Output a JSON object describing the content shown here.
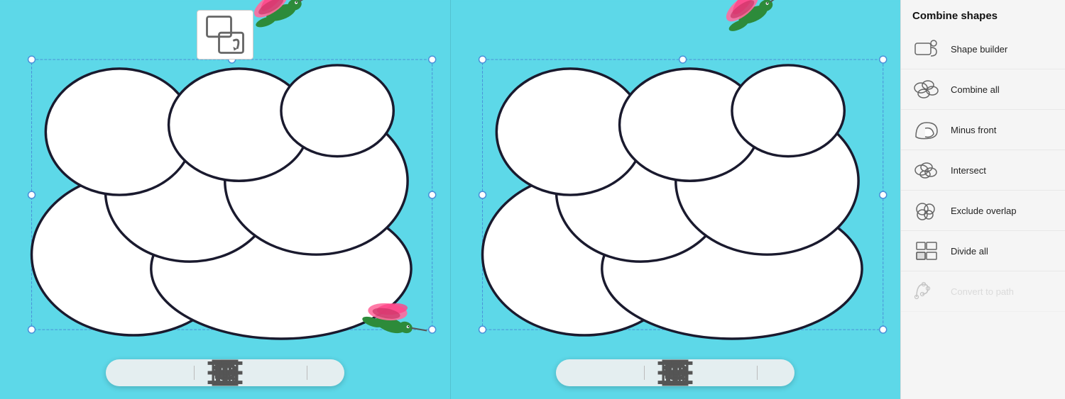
{
  "panel": {
    "title": "Combine shapes",
    "items": [
      {
        "id": "shape-builder",
        "label": "Shape builder",
        "disabled": false
      },
      {
        "id": "combine-all",
        "label": "Combine all",
        "disabled": false
      },
      {
        "id": "minus-front",
        "label": "Minus front",
        "disabled": false
      },
      {
        "id": "intersect",
        "label": "Intersect",
        "disabled": false
      },
      {
        "id": "exclude-overlap",
        "label": "Exclude overlap",
        "disabled": false
      },
      {
        "id": "divide-all",
        "label": "Divide all",
        "disabled": false
      },
      {
        "id": "convert-to-path",
        "label": "Convert to path",
        "disabled": true
      }
    ]
  },
  "toolbar": {
    "icons": [
      "grid",
      "menu",
      "layers",
      "add",
      "lock",
      "copy",
      "group",
      "trash"
    ]
  },
  "colors": {
    "bg": "#5dd8e8",
    "cloud_fill": "#ffffff",
    "cloud_stroke": "#1a1a2e",
    "guide_stroke": "#4a90d9",
    "panel_bg": "#f5f5f5"
  }
}
